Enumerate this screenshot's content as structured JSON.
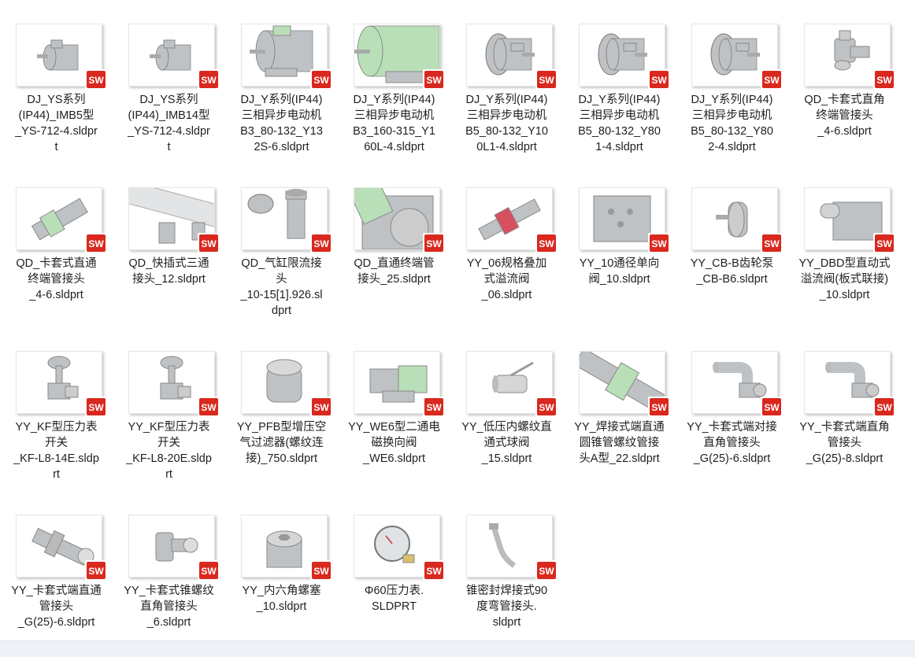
{
  "colors": {
    "part_gray": "#bfc2c4",
    "part_green": "#b9dfb8",
    "sw_red": "#d9281e"
  },
  "files": [
    {
      "label": "DJ_YS系列\n(IP44)_IMB5型\n_YS-712-4.sldpr\nt",
      "icon": "motor-small-icon"
    },
    {
      "label": "DJ_YS系列\n(IP44)_IMB14型\n_YS-712-4.sldpr\nt",
      "icon": "motor-small-icon"
    },
    {
      "label": "DJ_Y系列(IP44)\n三相异步电动机\nB3_80-132_Y13\n2S-6.sldprt",
      "icon": "motor-foot-icon"
    },
    {
      "label": "DJ_Y系列(IP44)\n三相异步电动机\nB3_160-315_Y1\n60L-4.sldprt",
      "icon": "motor-large-icon"
    },
    {
      "label": "DJ_Y系列(IP44)\n三相异步电动机\nB5_80-132_Y10\n0L1-4.sldprt",
      "icon": "motor-flange-icon"
    },
    {
      "label": "DJ_Y系列(IP44)\n三相异步电动机\nB5_80-132_Y80\n1-4.sldprt",
      "icon": "motor-flange-icon"
    },
    {
      "label": "DJ_Y系列(IP44)\n三相异步电动机\nB5_80-132_Y80\n2-4.sldprt",
      "icon": "motor-flange-icon"
    },
    {
      "label": "QD_卡套式直角\n终端管接头\n_4-6.sldprt",
      "icon": "elbow-fitting-icon"
    },
    {
      "label": "QD_卡套式直通\n终端管接头\n_4-6.sldprt",
      "icon": "straight-fitting-icon"
    },
    {
      "label": "QD_快插式三通\n接头_12.sldprt",
      "icon": "tee-fitting-icon"
    },
    {
      "label": "QD_气缸限流接\n头\n_10-15[1].926.sl\ndprt",
      "icon": "flow-limit-fitting-icon"
    },
    {
      "label": "QD_直通终端管\n接头_25.sldprt",
      "icon": "large-fitting-icon"
    },
    {
      "label": "YY_06规格叠加\n式溢流阀\n_06.sldprt",
      "icon": "stack-valve-icon"
    },
    {
      "label": "YY_10通径单向\n阀_10.sldprt",
      "icon": "block-valve-icon"
    },
    {
      "label": "YY_CB-B齿轮泵\n_CB-B6.sldprt",
      "icon": "gear-pump-icon"
    },
    {
      "label": "YY_DBD型直动式\n溢流阀(板式联接)\n_10.sldprt",
      "icon": "relief-valve-icon"
    },
    {
      "label": "YY_KF型压力表\n开关\n_KF-L8-14E.sldp\nrt",
      "icon": "gauge-switch-icon"
    },
    {
      "label": "YY_KF型压力表\n开关\n_KF-L8-20E.sldp\nrt",
      "icon": "gauge-switch-icon"
    },
    {
      "label": "YY_PFB型增压空\n气过滤器(螺纹连\n接)_750.sldprt",
      "icon": "filter-cap-icon"
    },
    {
      "label": "YY_WE6型二通电\n磁换向阀\n_WE6.sldprt",
      "icon": "solenoid-valve-icon"
    },
    {
      "label": "YY_低压内螺纹直\n通式球阀\n_15.sldprt",
      "icon": "ball-valve-icon"
    },
    {
      "label": "YY_焊接式端直通\n圆锥管螺纹管接\n头A型_22.sldprt",
      "icon": "weld-fitting-icon"
    },
    {
      "label": "YY_卡套式端对接\n直角管接头\n_G(25)-6.sldprt",
      "icon": "elbow-pipe-icon"
    },
    {
      "label": "YY_卡套式端直角\n管接头\n_G(25)-8.sldprt",
      "icon": "elbow-pipe-icon"
    },
    {
      "label": "YY_卡套式端直通\n管接头\n_G(25)-6.sldprt",
      "icon": "union-fitting-icon"
    },
    {
      "label": "YY_卡套式锥螺纹\n直角管接头\n_6.sldprt",
      "icon": "taper-elbow-icon"
    },
    {
      "label": "YY_内六角螺塞\n_10.sldprt",
      "icon": "hex-plug-icon"
    },
    {
      "label": "Φ60压力表.\nSLDPRT",
      "icon": "pressure-gauge-icon"
    },
    {
      "label": "锥密封焊接式90\n度弯管接头.\nsldprt",
      "icon": "bent-pipe-icon"
    }
  ]
}
